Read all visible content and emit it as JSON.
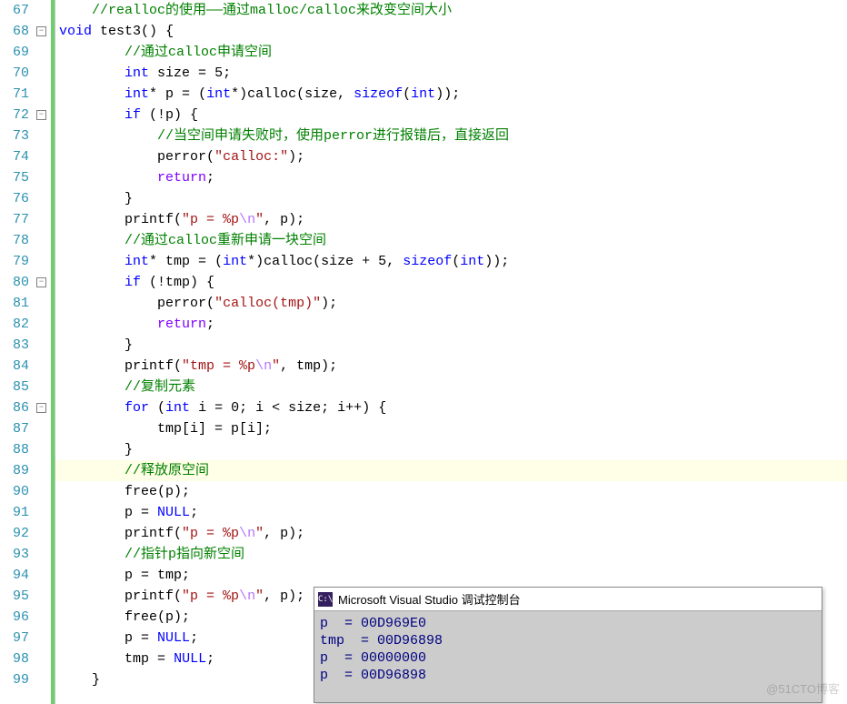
{
  "first_line_no": 67,
  "console": {
    "title": "Microsoft Visual Studio 调试控制台",
    "lines": [
      "p  = 00D969E0",
      "tmp  = 00D96898",
      "p  = 00000000",
      "p  = 00D96898"
    ]
  },
  "fold_buttons": [
    {
      "line": 68,
      "glyph": "−"
    },
    {
      "line": 72,
      "glyph": "−"
    },
    {
      "line": 80,
      "glyph": "−"
    },
    {
      "line": 86,
      "glyph": "−"
    }
  ],
  "highlight_line": 89,
  "watermark": "@51CTO博客",
  "code_lines": [
    {
      "n": 67,
      "tok": [
        [
          "    ",
          "op"
        ],
        [
          "//realloc的使用——通过malloc/calloc来改变空间大小",
          "cmt"
        ]
      ]
    },
    {
      "n": 68,
      "tok": [
        [
          "void",
          "kw"
        ],
        [
          " ",
          "op"
        ],
        [
          "test3",
          "fn"
        ],
        [
          "()",
          "op"
        ],
        [
          " {",
          "op"
        ]
      ]
    },
    {
      "n": 69,
      "tok": [
        [
          "        ",
          "op"
        ],
        [
          "//通过calloc申请空间",
          "cmt"
        ]
      ]
    },
    {
      "n": 70,
      "tok": [
        [
          "        ",
          "op"
        ],
        [
          "int",
          "type"
        ],
        [
          " size ",
          "id"
        ],
        [
          "=",
          "op"
        ],
        [
          " ",
          "op"
        ],
        [
          "5",
          "num"
        ],
        [
          ";",
          "op"
        ]
      ]
    },
    {
      "n": 71,
      "tok": [
        [
          "        ",
          "op"
        ],
        [
          "int",
          "type"
        ],
        [
          "* p ",
          "id"
        ],
        [
          "=",
          "op"
        ],
        [
          " (",
          "op"
        ],
        [
          "int",
          "type"
        ],
        [
          "*)",
          "op"
        ],
        [
          "calloc",
          "fn"
        ],
        [
          "(size, ",
          "id"
        ],
        [
          "sizeof",
          "kw"
        ],
        [
          "(",
          "op"
        ],
        [
          "int",
          "type"
        ],
        [
          "))",
          ";",
          "op"
        ],
        [
          ";",
          "op"
        ]
      ]
    },
    {
      "n": 72,
      "tok": [
        [
          "        ",
          "op"
        ],
        [
          "if",
          "kw"
        ],
        [
          " (!p) {",
          "op"
        ]
      ]
    },
    {
      "n": 73,
      "tok": [
        [
          "            ",
          "op"
        ],
        [
          "//当空间申请失败时，使用perror进行报错后，直接返回",
          "cmt"
        ]
      ]
    },
    {
      "n": 74,
      "tok": [
        [
          "            ",
          "op"
        ],
        [
          "perror",
          "fn"
        ],
        [
          "(",
          "op"
        ],
        [
          "\"calloc:\"",
          "str"
        ],
        [
          ")",
          ";",
          "op"
        ],
        [
          ";",
          "op"
        ]
      ]
    },
    {
      "n": 75,
      "tok": [
        [
          "            ",
          "op"
        ],
        [
          "return",
          "purple"
        ],
        [
          ";",
          "op"
        ]
      ]
    },
    {
      "n": 76,
      "tok": [
        [
          "        }",
          "op"
        ]
      ]
    },
    {
      "n": 77,
      "tok": [
        [
          "        ",
          "op"
        ],
        [
          "printf",
          "fn"
        ],
        [
          "(",
          "op"
        ],
        [
          "\"p = %p",
          "str"
        ],
        [
          "\\n",
          "esc"
        ],
        [
          "\"",
          "str"
        ],
        [
          ", p);",
          "op"
        ]
      ]
    },
    {
      "n": 78,
      "tok": [
        [
          "        ",
          "op"
        ],
        [
          "//通过calloc重新申请一块空间",
          "cmt"
        ]
      ]
    },
    {
      "n": 79,
      "tok": [
        [
          "        ",
          "op"
        ],
        [
          "int",
          "type"
        ],
        [
          "* tmp ",
          "id"
        ],
        [
          "=",
          "op"
        ],
        [
          " (",
          "op"
        ],
        [
          "int",
          "type"
        ],
        [
          "*)",
          "op"
        ],
        [
          "calloc",
          "fn"
        ],
        [
          "(size ",
          "id"
        ],
        [
          "+",
          "op"
        ],
        [
          " ",
          "op"
        ],
        [
          "5",
          "num"
        ],
        [
          ", ",
          "op"
        ],
        [
          "sizeof",
          "kw"
        ],
        [
          "(",
          "op"
        ],
        [
          "int",
          "type"
        ],
        [
          "));",
          "op"
        ]
      ]
    },
    {
      "n": 80,
      "tok": [
        [
          "        ",
          "op"
        ],
        [
          "if",
          "kw"
        ],
        [
          " (!tmp) {",
          "op"
        ]
      ]
    },
    {
      "n": 81,
      "tok": [
        [
          "            ",
          "op"
        ],
        [
          "perror",
          "fn"
        ],
        [
          "(",
          "op"
        ],
        [
          "\"calloc(tmp)\"",
          "str"
        ],
        [
          ");",
          "op"
        ]
      ]
    },
    {
      "n": 82,
      "tok": [
        [
          "            ",
          "op"
        ],
        [
          "return",
          "purple"
        ],
        [
          ";",
          "op"
        ]
      ]
    },
    {
      "n": 83,
      "tok": [
        [
          "        }",
          "op"
        ]
      ]
    },
    {
      "n": 84,
      "tok": [
        [
          "        ",
          "op"
        ],
        [
          "printf",
          "fn"
        ],
        [
          "(",
          "op"
        ],
        [
          "\"tmp = %p",
          "str"
        ],
        [
          "\\n",
          "esc"
        ],
        [
          "\"",
          "str"
        ],
        [
          ", tmp);",
          "op"
        ]
      ]
    },
    {
      "n": 85,
      "tok": [
        [
          "        ",
          "op"
        ],
        [
          "//复制元素",
          "cmt"
        ]
      ]
    },
    {
      "n": 86,
      "tok": [
        [
          "        ",
          "op"
        ],
        [
          "for",
          "kw"
        ],
        [
          " (",
          "op"
        ],
        [
          "int",
          "type"
        ],
        [
          " i ",
          "id"
        ],
        [
          "=",
          "op"
        ],
        [
          " ",
          "op"
        ],
        [
          "0",
          "num"
        ],
        [
          "; i ",
          "id"
        ],
        [
          "<",
          "op"
        ],
        [
          " size; i",
          "id"
        ],
        [
          "++",
          "op"
        ],
        [
          ") {",
          "op"
        ]
      ]
    },
    {
      "n": 87,
      "tok": [
        [
          "            tmp[i] ",
          "id"
        ],
        [
          "=",
          "op"
        ],
        [
          " p[i];",
          "id"
        ]
      ]
    },
    {
      "n": 88,
      "tok": [
        [
          "        }",
          "op"
        ]
      ]
    },
    {
      "n": 89,
      "tok": [
        [
          "        ",
          "op"
        ],
        [
          "//释放原空间",
          "cmt"
        ]
      ]
    },
    {
      "n": 90,
      "tok": [
        [
          "        ",
          "op"
        ],
        [
          "free",
          "fn"
        ],
        [
          "(p);",
          "op"
        ]
      ]
    },
    {
      "n": 91,
      "tok": [
        [
          "        p ",
          "id"
        ],
        [
          "=",
          "op"
        ],
        [
          " ",
          "op"
        ],
        [
          "NULL",
          "kw"
        ],
        [
          ";",
          "op"
        ]
      ]
    },
    {
      "n": 92,
      "tok": [
        [
          "        ",
          "op"
        ],
        [
          "printf",
          "fn"
        ],
        [
          "(",
          "op"
        ],
        [
          "\"p = %p",
          "str"
        ],
        [
          "\\n",
          "esc"
        ],
        [
          "\"",
          "str"
        ],
        [
          ", p);",
          "op"
        ]
      ]
    },
    {
      "n": 93,
      "tok": [
        [
          "        ",
          "op"
        ],
        [
          "//指针p指向新空间",
          "cmt"
        ]
      ]
    },
    {
      "n": 94,
      "tok": [
        [
          "        p ",
          "id"
        ],
        [
          "=",
          "op"
        ],
        [
          " tmp;",
          "id"
        ]
      ]
    },
    {
      "n": 95,
      "tok": [
        [
          "        ",
          "op"
        ],
        [
          "printf",
          "fn"
        ],
        [
          "(",
          "op"
        ],
        [
          "\"p = %p",
          "str"
        ],
        [
          "\\n",
          "esc"
        ],
        [
          "\"",
          "str"
        ],
        [
          ", p);",
          "op"
        ]
      ]
    },
    {
      "n": 96,
      "tok": [
        [
          "        ",
          "op"
        ],
        [
          "free",
          "fn"
        ],
        [
          "(p);",
          "op"
        ]
      ]
    },
    {
      "n": 97,
      "tok": [
        [
          "        p ",
          "id"
        ],
        [
          "=",
          "op"
        ],
        [
          " ",
          "op"
        ],
        [
          "NULL",
          "kw"
        ],
        [
          ";",
          "op"
        ]
      ]
    },
    {
      "n": 98,
      "tok": [
        [
          "        tmp ",
          "id"
        ],
        [
          "=",
          "op"
        ],
        [
          " ",
          "op"
        ],
        [
          "NULL",
          "kw"
        ],
        [
          ";",
          "op"
        ]
      ]
    },
    {
      "n": 99,
      "tok": [
        [
          "    }",
          "op"
        ]
      ]
    }
  ]
}
